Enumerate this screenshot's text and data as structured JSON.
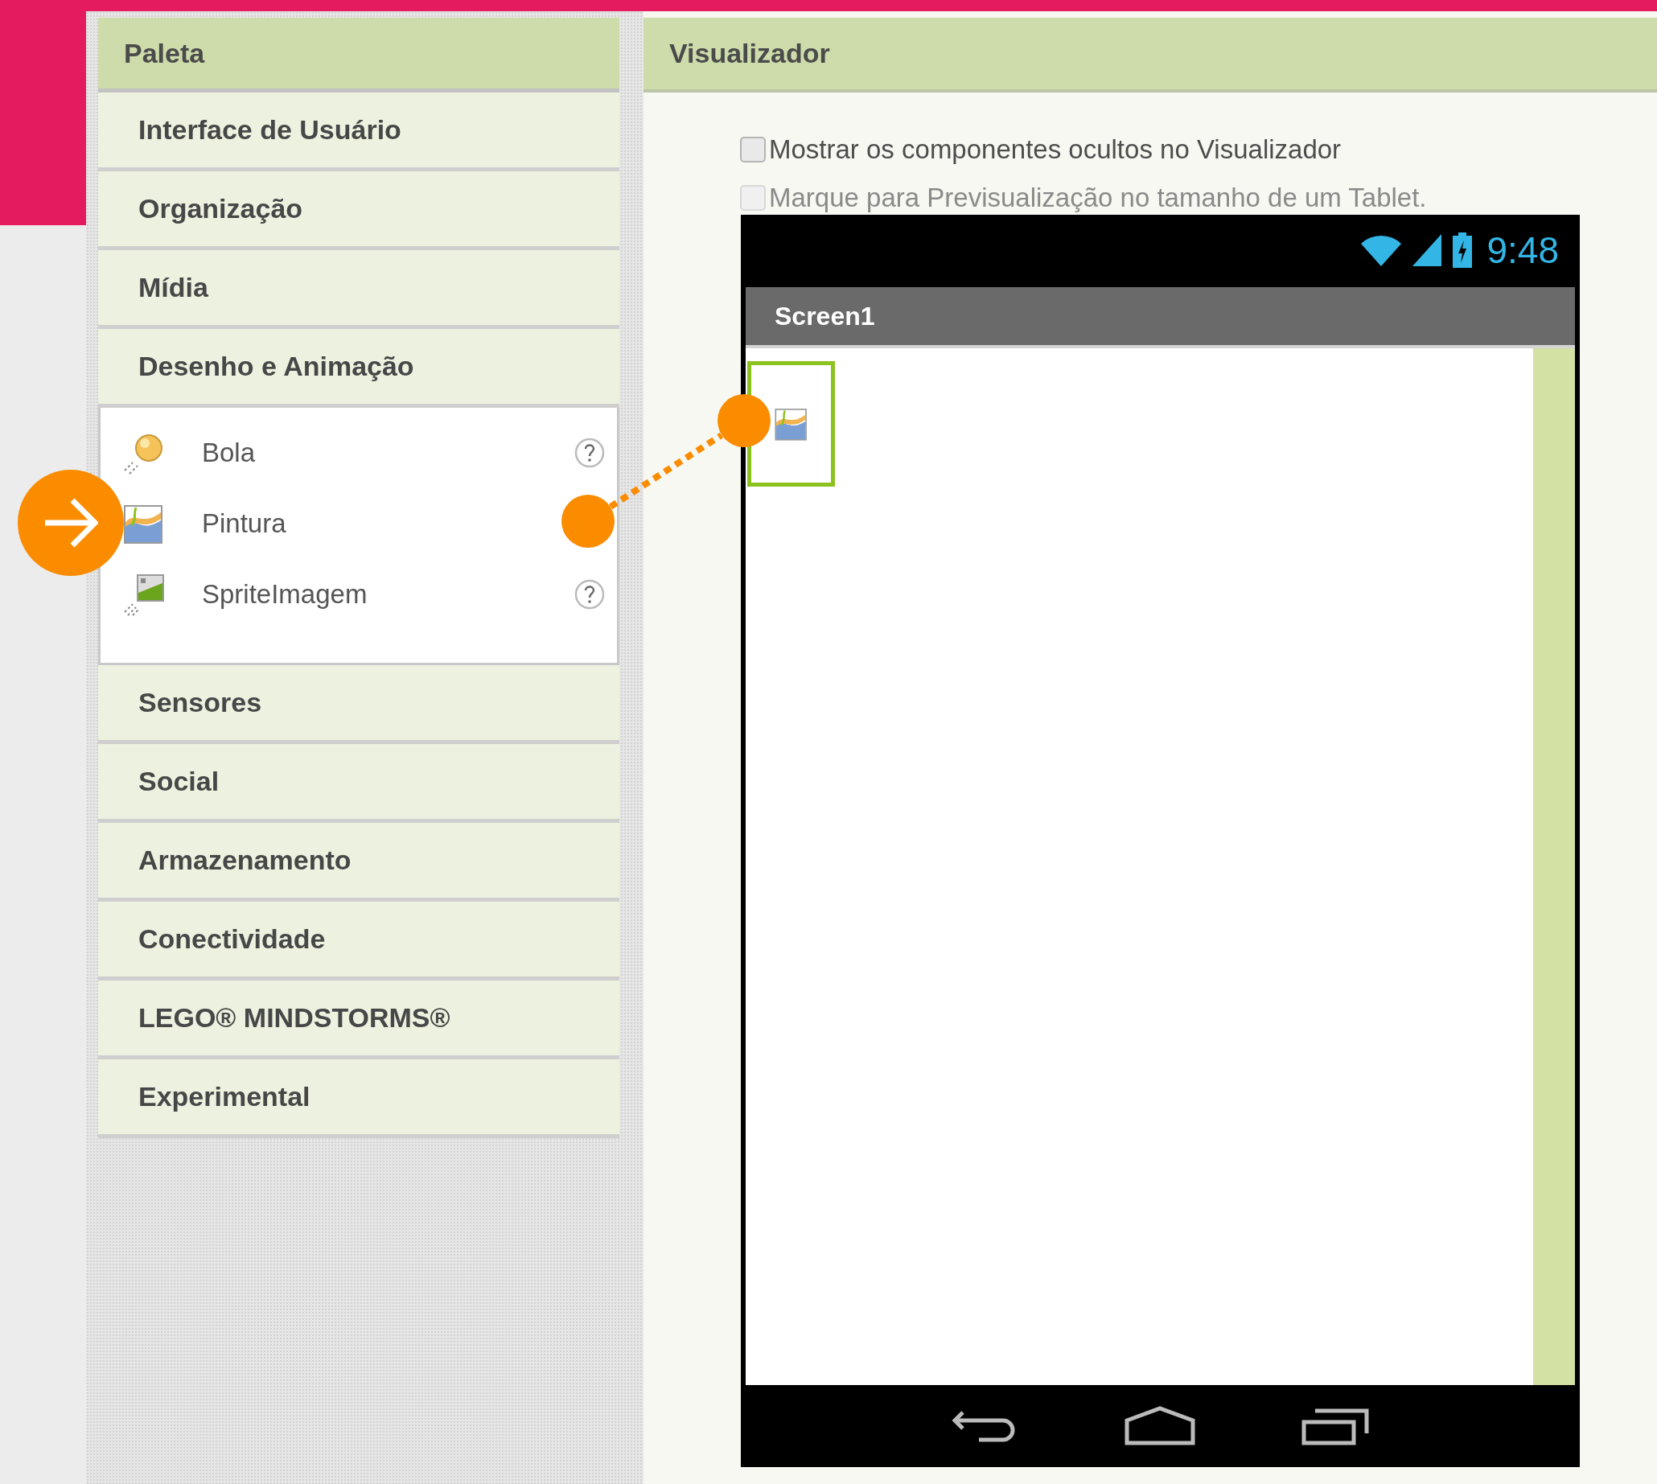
{
  "palette": {
    "title": "Paleta",
    "categories": [
      {
        "label": "Interface de Usuário",
        "expanded": false
      },
      {
        "label": "Organização",
        "expanded": false
      },
      {
        "label": "Mídia",
        "expanded": false
      },
      {
        "label": "Desenho e Animação",
        "expanded": true,
        "items": [
          {
            "label": "Bola",
            "kind": "ball",
            "help": true
          },
          {
            "label": "Pintura",
            "kind": "canvas",
            "help": false
          },
          {
            "label": "SpriteImagem",
            "kind": "sprite",
            "help": true
          }
        ]
      },
      {
        "label": "Sensores",
        "expanded": false
      },
      {
        "label": "Social",
        "expanded": false
      },
      {
        "label": "Armazenamento",
        "expanded": false
      },
      {
        "label": "Conectividade",
        "expanded": false
      },
      {
        "label": "LEGO® MINDSTORMS®",
        "expanded": false
      },
      {
        "label": "Experimental",
        "expanded": false
      }
    ]
  },
  "viewer": {
    "title": "Visualizador",
    "options": [
      {
        "label": "Mostrar os componentes ocultos no Visualizador",
        "checked": false,
        "disabled": false
      },
      {
        "label": "Marque para Previsualização no tamanho de um Tablet.",
        "checked": false,
        "disabled": true
      }
    ],
    "phone": {
      "time": "9:48",
      "screen_title": "Screen1",
      "components": [
        {
          "kind": "canvas",
          "selected": true
        }
      ]
    }
  }
}
